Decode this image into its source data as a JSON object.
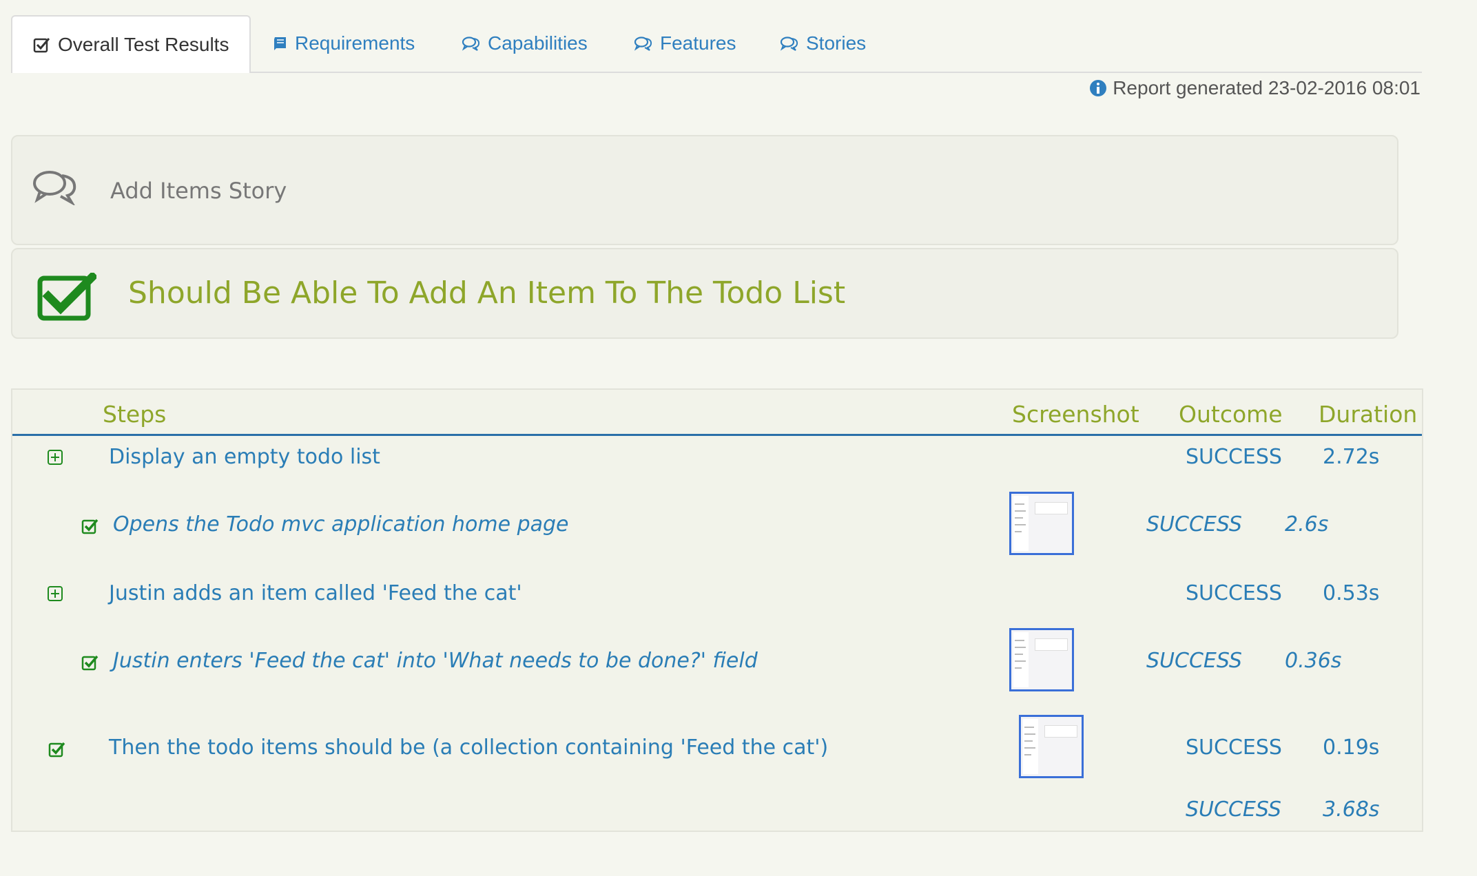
{
  "tabs": [
    {
      "label": "Overall Test Results",
      "icon": "check-square-icon",
      "active": true
    },
    {
      "label": "Requirements",
      "icon": "book-icon",
      "active": false
    },
    {
      "label": "Capabilities",
      "icon": "comments-icon",
      "active": false
    },
    {
      "label": "Features",
      "icon": "comments-icon",
      "active": false
    },
    {
      "label": "Stories",
      "icon": "comments-icon",
      "active": false
    }
  ],
  "report": {
    "generated": "Report generated 23-02-2016 08:01"
  },
  "story": {
    "title": "Add Items Story",
    "icon": "comments-icon"
  },
  "scenario": {
    "title": "Should Be Able To Add An Item To The Todo List",
    "icon": "check-square-icon"
  },
  "steps_table": {
    "headers": {
      "steps": "Steps",
      "screenshot": "Screenshot",
      "outcome": "Outcome",
      "duration": "Duration"
    },
    "rows": [
      {
        "description": "Display an empty todo list",
        "icon": "plus-square-icon",
        "outcome": "SUCCESS",
        "duration": "2.72s"
      },
      {
        "description": "Opens the Todo mvc application home page",
        "icon": "check-square-icon",
        "outcome": "SUCCESS",
        "duration": "2.6s"
      },
      {
        "description": "Justin adds an item called 'Feed the cat'",
        "icon": "plus-square-icon",
        "outcome": "SUCCESS",
        "duration": "0.53s"
      },
      {
        "description": "Justin enters 'Feed the cat' into 'What needs to be done?' field",
        "icon": "check-square-icon",
        "outcome": "SUCCESS",
        "duration": "0.36s"
      },
      {
        "description": "Then the todo items should be (a collection containing 'Feed the cat')",
        "icon": "check-square-icon",
        "outcome": "SUCCESS",
        "duration": "0.19s"
      }
    ],
    "total": {
      "outcome": "SUCCESS",
      "duration": "3.68s"
    }
  },
  "colors": {
    "accent_green": "#8ea62a",
    "link_blue": "#2a7db6",
    "check_green": "#1e8a1e"
  }
}
